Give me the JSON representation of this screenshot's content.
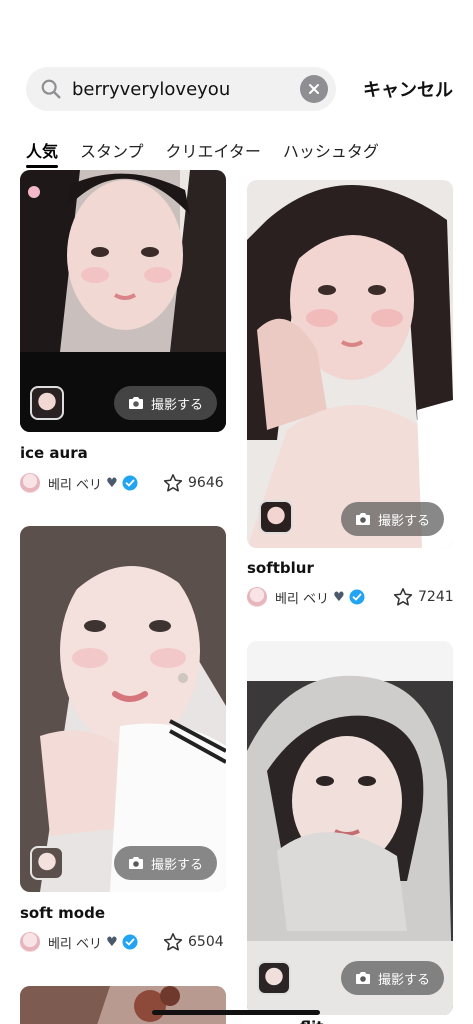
{
  "search": {
    "value": "berryveryloveyou",
    "placeholder": "",
    "cancel_label": "キャンセル"
  },
  "tabs": [
    {
      "label": "人気",
      "active": true
    },
    {
      "label": "スタンプ",
      "active": false
    },
    {
      "label": "クリエイター",
      "active": false
    },
    {
      "label": "ハッシュタグ",
      "active": false
    }
  ],
  "shoot_label": "撮影する",
  "author": {
    "name": "베리 ベリ",
    "heart": "♥"
  },
  "cards": [
    {
      "title": "ice aura",
      "stars": "9646"
    },
    {
      "title": "softblur",
      "stars": "7241"
    },
    {
      "title": "soft mode",
      "stars": "6504"
    },
    {
      "title": "",
      "stars": ""
    },
    {
      "title": "flit",
      "stars": ""
    }
  ],
  "colors": {
    "verified": "#20a4f3",
    "clear": "#8e8e93",
    "search_bg": "#f1f1f1"
  }
}
